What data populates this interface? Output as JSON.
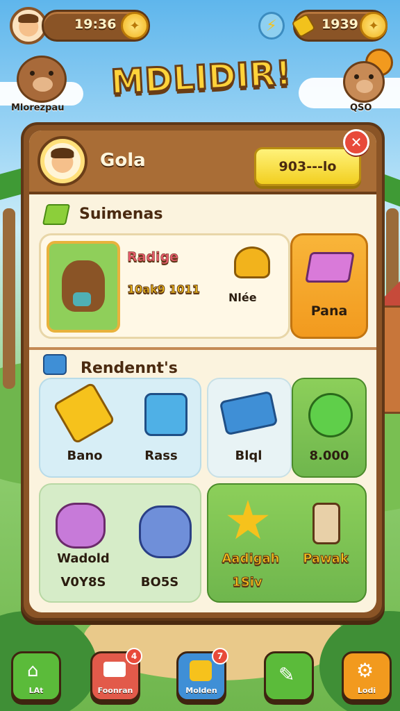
{
  "top_bar": {
    "time_value": "19:36",
    "coins_value": "1939"
  },
  "title": "MDLIDIR!",
  "characters": {
    "left_label": "Mlorezpau",
    "right_label": "QSO"
  },
  "profile": {
    "name": "Gola",
    "action_button": "903---lo"
  },
  "section_1": {
    "title": "Suimenas",
    "featured_name": "Radige",
    "featured_stat": "10ak9 1011",
    "item_label": "Nlée",
    "side_label": "Pana"
  },
  "section_2": {
    "title": "Rendennt's",
    "items": [
      {
        "label": "Bano"
      },
      {
        "label": "Rass"
      },
      {
        "label": "Blql"
      },
      {
        "label": "8.000"
      }
    ],
    "items_row2": [
      {
        "label": "Wadold",
        "sub": "V0Y8S"
      },
      {
        "label": "",
        "sub": "BO5S"
      },
      {
        "label": "Aadigah",
        "sub": "1Siv"
      },
      {
        "label": "Pawak",
        "sub": ""
      }
    ]
  },
  "nav": [
    {
      "label": "LAt",
      "icon": "home-icon",
      "color": "#5bbb3a"
    },
    {
      "label": "Foonran",
      "icon": "mail-icon",
      "color": "#e25a4a",
      "badge": "4"
    },
    {
      "label": "Molden",
      "icon": "shop-icon",
      "color": "#3f8fd6",
      "badge": "7"
    },
    {
      "label": "",
      "icon": "map-icon",
      "color": "#5bbb3a"
    },
    {
      "label": "Lodi",
      "icon": "settings-icon",
      "color": "#f29a1e"
    }
  ],
  "colors": {
    "panel_brown": "#8a5426",
    "accent_yellow": "#f6c21c",
    "green_card": "#7dc25a",
    "orange_card": "#f4a820"
  }
}
